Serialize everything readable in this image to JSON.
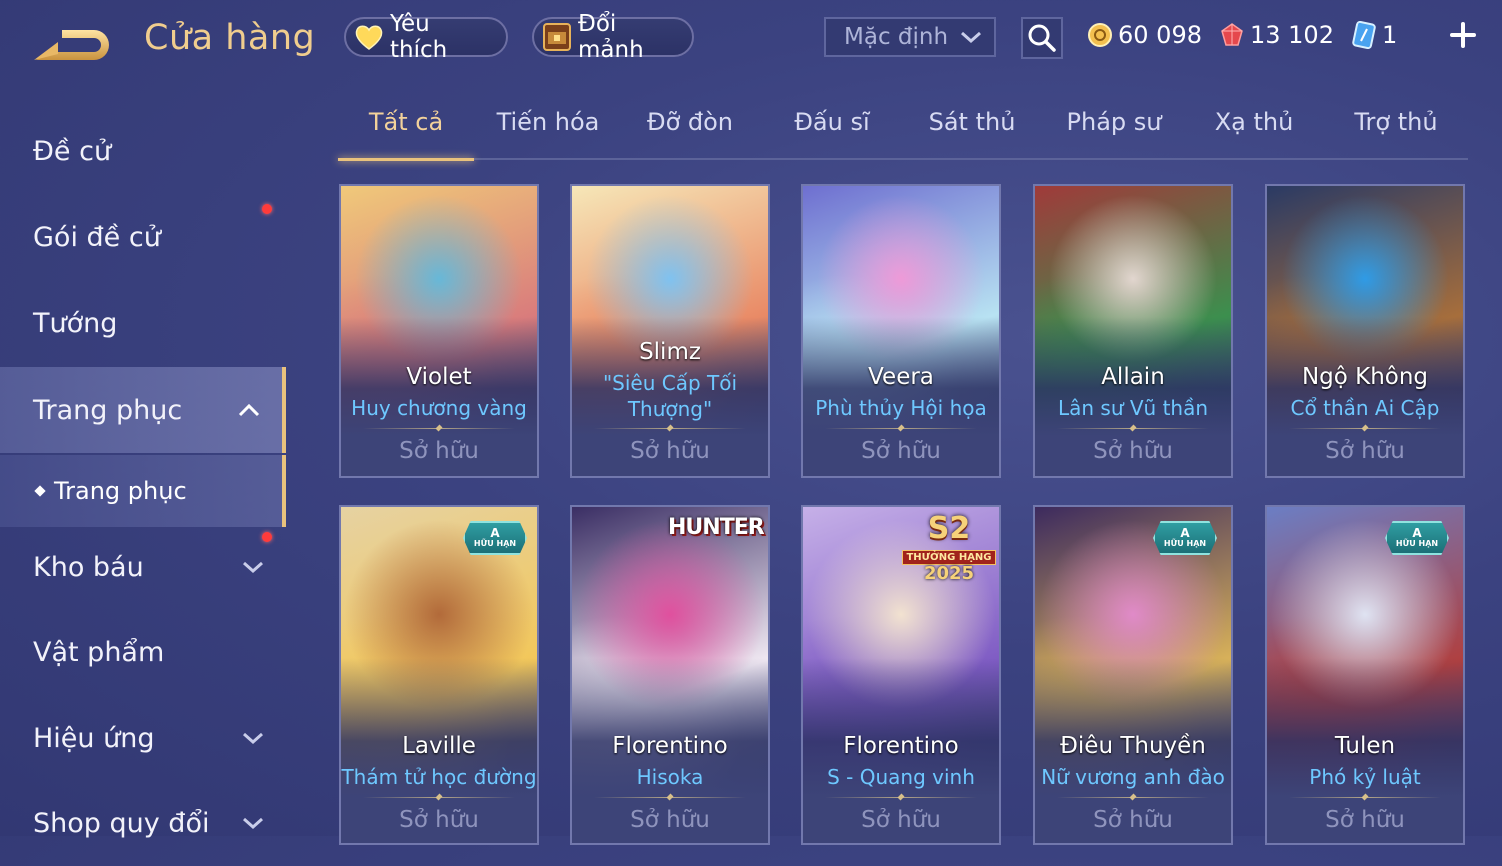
{
  "header": {
    "title": "Cửa hàng",
    "favorites_label": "Yêu thích",
    "exchange_label": "Đổi mảnh",
    "sort": {
      "selected": "Mặc định"
    },
    "currencies": [
      {
        "icon": "gold-coin-icon",
        "value": "60 098"
      },
      {
        "icon": "ruby-gem-icon",
        "value": "13 102"
      },
      {
        "icon": "voucher-card-icon",
        "value": "1"
      }
    ]
  },
  "sidebar": {
    "items": [
      {
        "label": "Đề cử",
        "has_dot": false,
        "chevron": "none"
      },
      {
        "label": "Gói đề cử",
        "has_dot": true,
        "chevron": "none"
      },
      {
        "label": "Tướng",
        "has_dot": false,
        "chevron": "none"
      },
      {
        "label": "Trang phục",
        "has_dot": false,
        "chevron": "up",
        "active": true
      },
      {
        "label": "Kho báu",
        "has_dot": true,
        "chevron": "down"
      },
      {
        "label": "Vật phẩm",
        "has_dot": false,
        "chevron": "none"
      },
      {
        "label": "Hiệu ứng",
        "has_dot": false,
        "chevron": "down"
      },
      {
        "label": "Shop quy đổi",
        "has_dot": false,
        "chevron": "down"
      }
    ],
    "subitem": {
      "label": "Trang phục"
    }
  },
  "tabs": [
    {
      "label": "Tất cả",
      "active": true
    },
    {
      "label": "Tiến hóa"
    },
    {
      "label": "Đỡ đòn"
    },
    {
      "label": "Đấu sĩ"
    },
    {
      "label": "Sát thủ"
    },
    {
      "label": "Pháp sư"
    },
    {
      "label": "Xạ thủ"
    },
    {
      "label": "Trợ thủ"
    }
  ],
  "cards": [
    {
      "hero": "Violet",
      "skin": "Huy chương vàng",
      "status": "Sở hữu",
      "art": [
        "#f0c97a",
        "#67b8d8",
        "#d97c7c"
      ]
    },
    {
      "hero": "Slimz",
      "skin": "\"Siêu Cấp Tối Thượng\"",
      "status": "Sở hữu",
      "art": [
        "#f6e7b8",
        "#7fc2f0",
        "#e98a66"
      ]
    },
    {
      "hero": "Veera",
      "skin": "Phù thủy Hội họa",
      "status": "Sở hữu",
      "art": [
        "#6e6fd0",
        "#ee9ad8",
        "#b8e2f2"
      ]
    },
    {
      "hero": "Allain",
      "skin": "Lân sư Vũ thần",
      "status": "Sở hữu",
      "art": [
        "#a03a3a",
        "#e2d6cf",
        "#3c8f4e"
      ]
    },
    {
      "hero": "Ngộ Không",
      "skin": "Cổ thần Ai Cập",
      "status": "Sở hữu",
      "art": [
        "#2a3a64",
        "#2f9be6",
        "#a66e3c"
      ]
    },
    {
      "hero": "Laville",
      "skin": "Thám tử học đường",
      "status": "Sở hữu",
      "art": [
        "#e6d2a2",
        "#b26a3a",
        "#f2c75a"
      ],
      "badge": {
        "top": "A",
        "bottom": "HỮU HẠN"
      }
    },
    {
      "hero": "Florentino",
      "skin": "Hisoka",
      "status": "Sở hữu",
      "art": [
        "#3a2e64",
        "#e0509e",
        "#f0e8f2"
      ],
      "logo": "HUNTER"
    },
    {
      "hero": "Florentino",
      "skin": "S - Quang vinh",
      "status": "Sở hữu",
      "art": [
        "#c6b0e8",
        "#f2e2d0",
        "#7f5cc4"
      ],
      "logo_s2": {
        "big": "S2",
        "rank": "THƯỞNG HẠNG",
        "year": "2025"
      }
    },
    {
      "hero": "Điêu Thuyền",
      "skin": "Nữ vương anh đào",
      "status": "Sở hữu",
      "art": [
        "#3c2a5e",
        "#e08ac8",
        "#d9b25a"
      ],
      "badge": {
        "top": "A",
        "bottom": "HỮU HẠN"
      }
    },
    {
      "hero": "Tulen",
      "skin": "Phó kỷ luật",
      "status": "Sở hữu",
      "art": [
        "#6b7ec4",
        "#dfe3f2",
        "#b04040"
      ],
      "badge": {
        "top": "A",
        "bottom": "HỮU HẠN"
      }
    }
  ]
}
